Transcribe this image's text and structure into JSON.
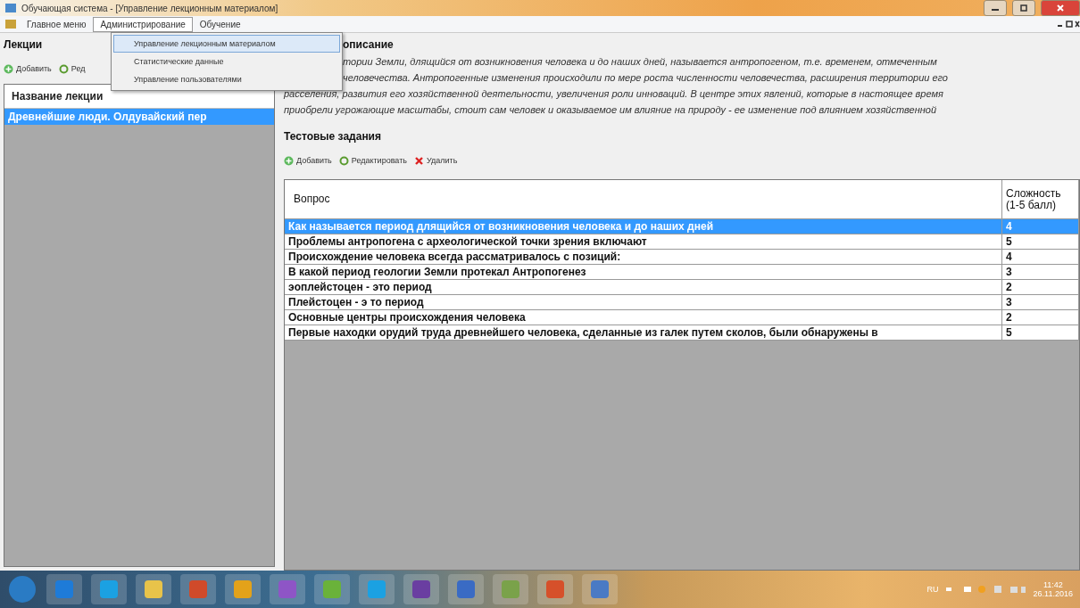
{
  "window": {
    "title": "Обучающая система - [Управление лекционным материалом]"
  },
  "menu": [
    {
      "label": "Главное меню",
      "selected": false
    },
    {
      "label": "Администрирование",
      "selected": true
    },
    {
      "label": "Обучение",
      "selected": false
    }
  ],
  "dropdown": [
    {
      "label": "Управление лекционным материалом",
      "selected": true
    },
    {
      "label": "Статистические данные",
      "selected": false
    },
    {
      "label": "Управление пользователями",
      "selected": false
    }
  ],
  "lectures": {
    "title": "Лекции",
    "toolbar": [
      {
        "kind": "add",
        "label": "Добавить"
      },
      {
        "kind": "edit",
        "label": "Ред"
      }
    ],
    "column": "Название лекции",
    "items": [
      {
        "label": "Древнейшие люди. Олдувайский пер",
        "selected": true
      }
    ]
  },
  "description": {
    "title": "описание",
    "lines": [
      {
        "text": "тории Земли, длящийся от возникновения человека и до наших дней, называется антропогеном, т.е. временем, отмеченным",
        "covered": true
      },
      {
        "text": "человечества. Антропогенные изменения происходили по мере роста численности человечества, расширения территории его",
        "covered": true
      },
      {
        "text": "расселения, развития его хозяйственной деятельности, увеличения роли инноваций. В центре этих явлений, которые в настоящее время",
        "covered": false
      },
      {
        "text": "приобрели угрожающие масштабы, стоит сам человек и оказываемое им влияние на природу - ее изменение под влиянием хозяйственной",
        "covered": false
      }
    ]
  },
  "tests": {
    "title": "Тестовые задания",
    "toolbar": [
      {
        "kind": "add",
        "label": "Добавить"
      },
      {
        "kind": "edit",
        "label": "Редактировать"
      },
      {
        "kind": "delete",
        "label": "Удалить"
      }
    ],
    "columns": [
      "Вопрос",
      "Сложность (1-5 балл)"
    ],
    "rows": [
      {
        "question": "Как называется период длящийся от возникновения человека и до наших дней",
        "difficulty": "4",
        "selected": true
      },
      {
        "question": "Проблемы антропогена с археологической точки зрения включают",
        "difficulty": "5",
        "selected": false
      },
      {
        "question": "Происхождение человека всегда рассматривалось с позиций:",
        "difficulty": "4",
        "selected": false
      },
      {
        "question": "В какой период геологии Земли протекал Антропогенез",
        "difficulty": "3",
        "selected": false
      },
      {
        "question": "эоплейстоцен - это период",
        "difficulty": "2",
        "selected": false
      },
      {
        "question": "Плейстоцен - э то период",
        "difficulty": "3",
        "selected": false
      },
      {
        "question": "Основные центры происхождения человека",
        "difficulty": "2",
        "selected": false
      },
      {
        "question": " Первые находки орудий труда древнейшего человека, сделанные из галек путем сколов, были обнаружены в",
        "difficulty": "5",
        "selected": false
      }
    ]
  },
  "taskbar": {
    "language": "RU",
    "time": "11:42",
    "date": "26.11.2016"
  }
}
